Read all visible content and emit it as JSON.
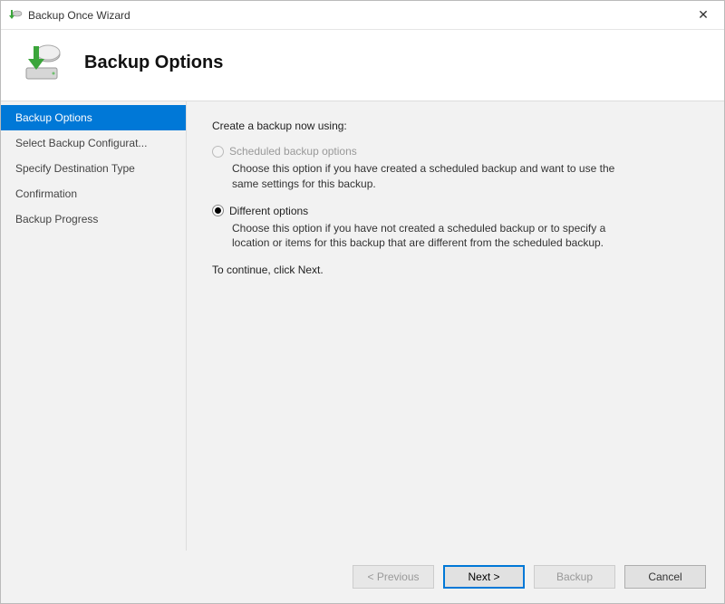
{
  "window": {
    "title": "Backup Once Wizard"
  },
  "header": {
    "heading": "Backup Options"
  },
  "sidebar": {
    "steps": [
      {
        "label": "Backup Options",
        "active": true
      },
      {
        "label": "Select Backup Configurat...",
        "active": false
      },
      {
        "label": "Specify Destination Type",
        "active": false
      },
      {
        "label": "Confirmation",
        "active": false
      },
      {
        "label": "Backup Progress",
        "active": false
      }
    ]
  },
  "main": {
    "prompt": "Create a backup now using:",
    "options": [
      {
        "id": "scheduled",
        "label": "Scheduled backup options",
        "description": "Choose this option if you have created a scheduled backup and want to use the same settings for this backup.",
        "selected": false,
        "enabled": false
      },
      {
        "id": "different",
        "label": "Different options",
        "description": "Choose this option if you have not created a scheduled backup or to specify a location or items for this backup that are different from the scheduled backup.",
        "selected": true,
        "enabled": true
      }
    ],
    "continue_text": "To continue, click Next."
  },
  "footer": {
    "buttons": {
      "previous": {
        "label": "< Previous",
        "enabled": false
      },
      "next": {
        "label": "Next >",
        "enabled": true,
        "primary": true
      },
      "backup": {
        "label": "Backup",
        "enabled": false
      },
      "cancel": {
        "label": "Cancel",
        "enabled": true
      }
    }
  }
}
